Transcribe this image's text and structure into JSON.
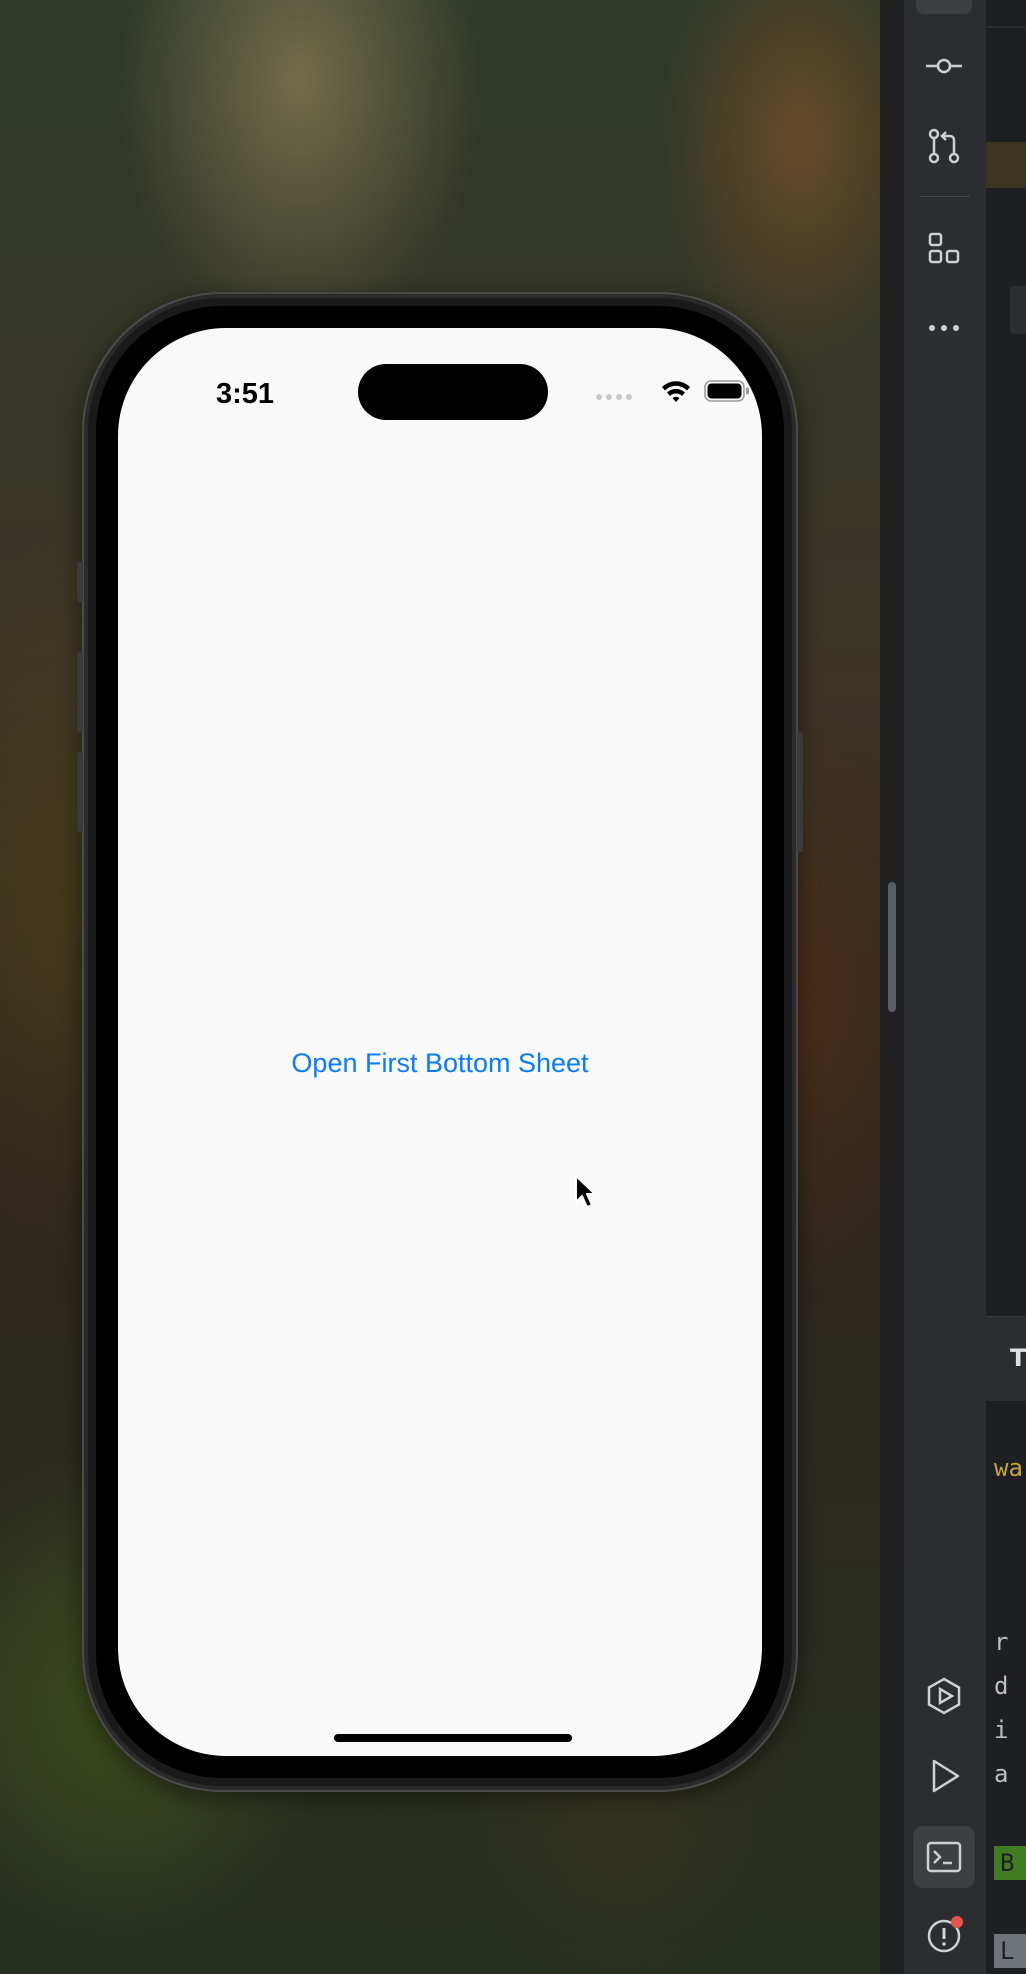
{
  "simulator": {
    "status_bar": {
      "time": "3:51",
      "icons": [
        "cellular-dots-icon",
        "wifi-icon",
        "battery-icon"
      ]
    },
    "content": {
      "open_button_label": "Open First Bottom Sheet"
    },
    "accent_color": "#0a7aff"
  },
  "ide": {
    "rail_icons": [
      "menu-icon",
      "commit-icon",
      "pull-request-icon",
      "structure-icon",
      "more-icon",
      "services-icon",
      "run-icon",
      "terminal-icon",
      "problems-icon"
    ],
    "tool_window_tab_fragment": "T",
    "code_fragments": {
      "warning": "wa",
      "line1": "r",
      "line2": "d",
      "line3": "i",
      "line4": "a"
    },
    "badges": {
      "build": "B",
      "log": "L"
    }
  }
}
